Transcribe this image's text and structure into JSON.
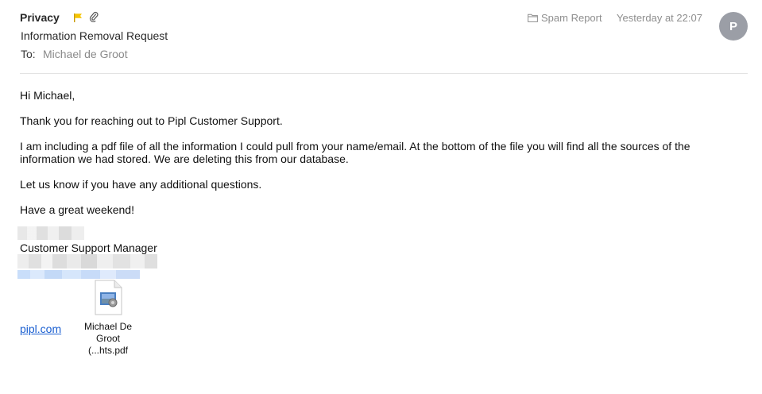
{
  "header": {
    "sender": "Privacy",
    "subject": "Information Removal Request",
    "to_label": "To:",
    "to_value": "Michael de Groot",
    "mailbox": "Spam Report",
    "datetime": "Yesterday at 22:07",
    "avatar_initial": "P",
    "flag_icon": "flag-icon",
    "attachment_icon": "paperclip-icon",
    "flag_color": "#f5c400",
    "avatar_color": "#9b9ea6"
  },
  "body": {
    "greeting": "Hi Michael,",
    "line1": "Thank you for reaching out to Pipl Customer Support.",
    "line2": "I am including a pdf file of all the information I could pull from your name/email. At the bottom of the file you will find all the sources of the information we had stored. We are deleting this from our database.",
    "line3": "Let us know if you have any additional questions.",
    "line4": "Have a great weekend!"
  },
  "signature": {
    "title": "Customer Support Manager",
    "link": "pipl.com",
    "link_color": "#1a5fd1"
  },
  "attachment": {
    "name_line1": "Michael De",
    "name_line2": "Groot (...hts.pdf",
    "icon": "pdf-file-icon"
  }
}
